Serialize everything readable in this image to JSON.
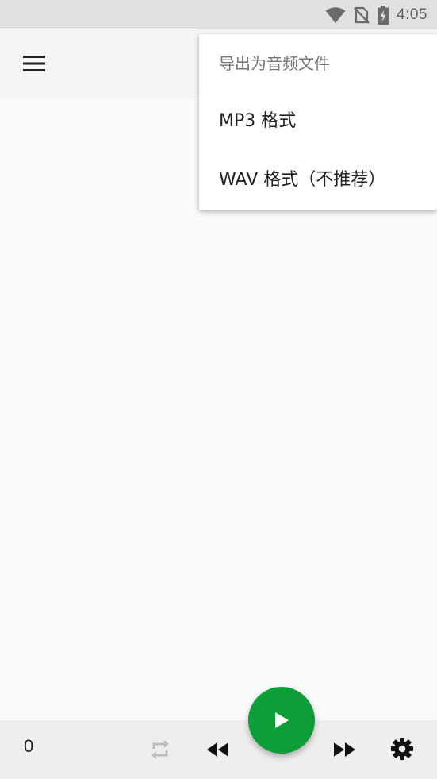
{
  "status_bar": {
    "time": "4:05",
    "icons": [
      "wifi-icon",
      "no-sim-icon",
      "battery-charging-icon"
    ]
  },
  "app_bar": {
    "icon": "hamburger-menu-icon"
  },
  "popup_menu": {
    "header": "导出为音频文件",
    "items": [
      {
        "label": "MP3 格式"
      },
      {
        "label": "WAV 格式（不推荐）"
      }
    ]
  },
  "bottom_bar": {
    "counter": "0",
    "controls": {
      "repeat": "repeat-icon",
      "rewind": "rewind-icon",
      "play": "play-icon",
      "forward": "fast-forward-icon",
      "settings": "gear-icon"
    }
  },
  "colors": {
    "accent": "#0f9d3a",
    "status_bar": "#e0e0e0",
    "app_bar": "#f5f5f5",
    "bottom_bar": "#eeeeee",
    "disabled_icon": "#bdbdbd"
  }
}
